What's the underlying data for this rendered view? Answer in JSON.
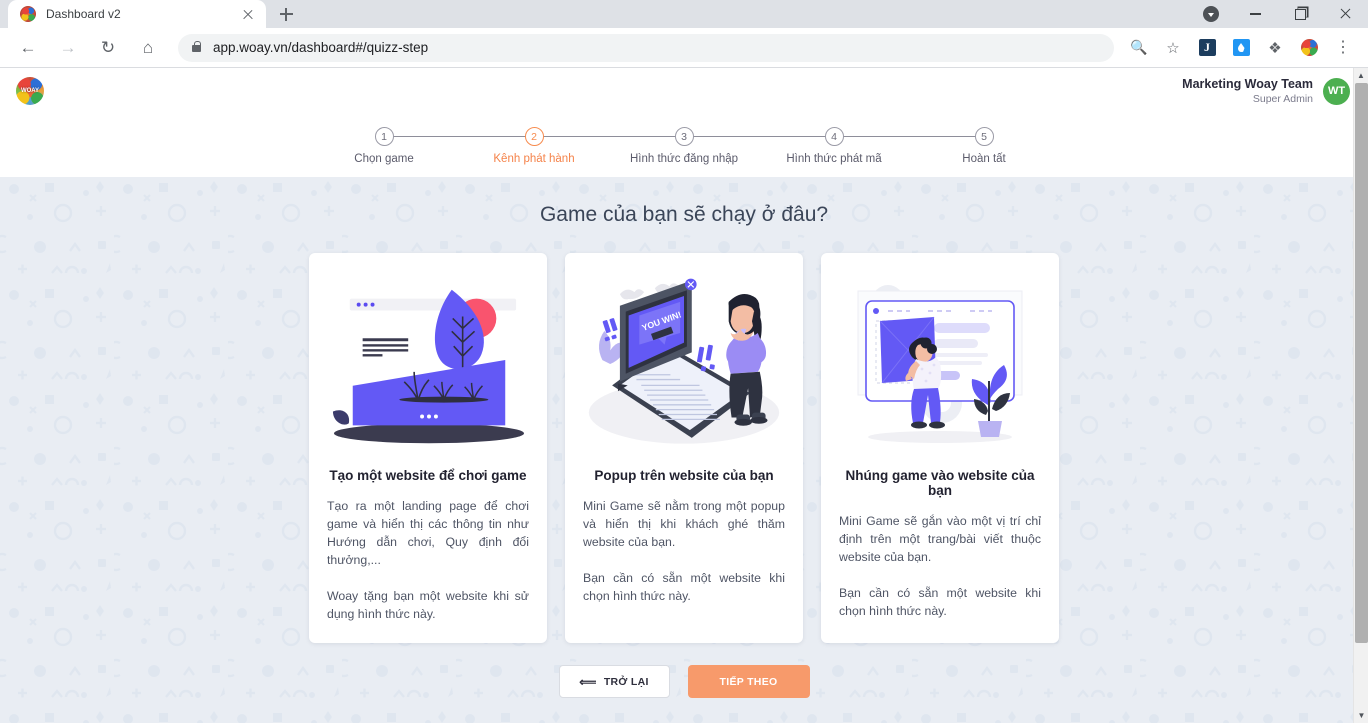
{
  "browser": {
    "tab": {
      "title": "Dashboard v2",
      "favicon_icon": "woay-logo-icon",
      "close_icon": "close-icon"
    },
    "new_tab_icon": "plus-icon",
    "window_controls": {
      "download_icon": "download-arrow-icon",
      "minimize_icon": "minimize-icon",
      "maximize_icon": "maximize-icon",
      "close_icon": "close-icon"
    },
    "nav": {
      "back_icon": "arrow-left-icon",
      "forward_icon": "arrow-right-icon",
      "reload_icon": "reload-icon",
      "home_icon": "home-icon"
    },
    "omnibox": {
      "lock_icon": "lock-icon",
      "url": "app.woay.vn/dashboard#/quizz-step"
    },
    "toolbar_icons": [
      {
        "name": "zoom-out-icon",
        "glyph": "⊖"
      },
      {
        "name": "bookmark-star-icon",
        "glyph": "☆"
      },
      {
        "name": "extension-journal-icon",
        "label": "J"
      },
      {
        "name": "extension-water-drop-icon",
        "label": ""
      },
      {
        "name": "extensions-puzzle-icon",
        "glyph": "❖"
      },
      {
        "name": "extension-woay-icon",
        "label": ""
      },
      {
        "name": "chrome-menu-icon",
        "glyph": "⋮"
      }
    ]
  },
  "app_header": {
    "logo_icon": "woay-logo-icon",
    "user_name": "Marketing Woay Team",
    "user_role": "Super Admin",
    "avatar_initials": "WT",
    "avatar_color": "#4caf50"
  },
  "stepper": {
    "active_index": 1,
    "active_color": "#f5834a",
    "steps": [
      {
        "number": "1",
        "label": "Chọn game"
      },
      {
        "number": "2",
        "label": "Kênh phát hành"
      },
      {
        "number": "3",
        "label": "Hình thức đăng nhập"
      },
      {
        "number": "4",
        "label": "Hình thức phát mã"
      },
      {
        "number": "5",
        "label": "Hoàn tất"
      }
    ]
  },
  "main": {
    "title": "Game của bạn sẽ chạy ở đâu?",
    "cards": [
      {
        "illustration": "landing-page-website-illustration",
        "title": "Tạo một website để chơi game",
        "paragraph1": "Tạo ra một landing page để chơi game và hiển thị các thông tin như Hướng dẫn chơi, Quy định đổi thưởng,...",
        "paragraph2": "Woay tặng bạn một website khi sử dụng hình thức này."
      },
      {
        "illustration": "popup-you-win-illustration",
        "title": "Popup trên website của bạn",
        "paragraph1": "Mini Game sẽ nằm trong một popup và hiển thị khi khách ghé thăm website của bạn.",
        "paragraph2": "Bạn cần có sẵn một website khi chọn hình thức này."
      },
      {
        "illustration": "embed-game-website-illustration",
        "title": "Nhúng game vào website của bạn",
        "paragraph1": "Mini Game sẽ gắn vào một vị trí chỉ định trên một trang/bài viết thuộc website của bạn.",
        "paragraph2": "Bạn cần có sẵn một website khi chọn hình thức này."
      }
    ],
    "popup_badge_text": "YOU WIN!"
  },
  "footer": {
    "back_label": "TRỞ LẠI",
    "back_icon": "arrow-left-icon",
    "next_label": "TIẾP THEO",
    "next_color": "#f79a6b"
  },
  "scrollbar": {
    "up_icon": "caret-up-icon",
    "down_icon": "caret-down-icon"
  }
}
